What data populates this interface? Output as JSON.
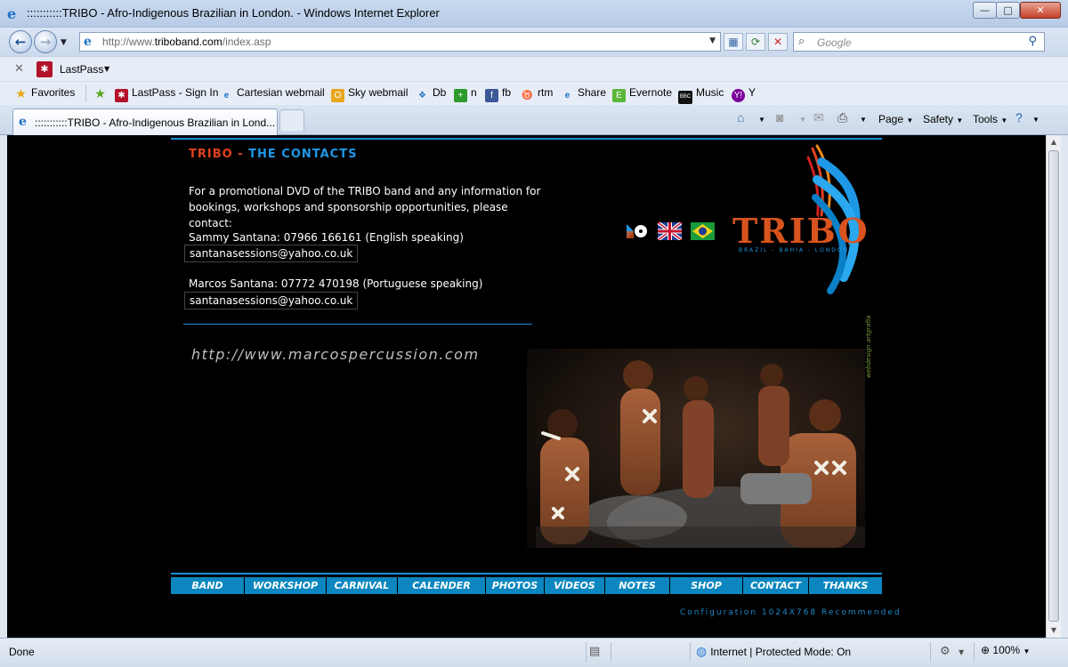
{
  "window": {
    "title": ":::::::::::TRIBO - Afro-Indigenous Brazilian in London. - Windows Internet Explorer",
    "minimize": "—",
    "maximize": "□",
    "close": "✕"
  },
  "address": {
    "url_prefix": "http://www.",
    "url_domain": "triboband.com",
    "url_path": "/index.asp",
    "search_placeholder": "Google"
  },
  "lastpass": {
    "label": "LastPass"
  },
  "favorites": {
    "label": "Favorites",
    "items": [
      {
        "label": "LastPass - Sign In",
        "icon": "lastpass-icon"
      },
      {
        "label": "Cartesian webmail",
        "icon": "ie-page-icon"
      },
      {
        "label": "Sky webmail",
        "icon": "outlook-icon"
      },
      {
        "label": "Db",
        "icon": "dropbox-icon"
      },
      {
        "label": "n",
        "icon": "plus-icon"
      },
      {
        "label": "fb",
        "icon": "facebook-icon"
      },
      {
        "label": "rtm",
        "icon": "cow-icon"
      },
      {
        "label": "Share",
        "icon": "ie-page-icon"
      },
      {
        "label": "Evernote",
        "icon": "evernote-icon"
      },
      {
        "label": "Music",
        "icon": "bbc-icon"
      },
      {
        "label": "Y",
        "icon": "yahoo-icon"
      }
    ]
  },
  "tab": {
    "label": ":::::::::::TRIBO - Afro-Indigenous Brazilian in Lond..."
  },
  "commandbar": {
    "page": "Page",
    "safety": "Safety",
    "tools": "Tools"
  },
  "site": {
    "heading_red": "TRIBO - ",
    "heading_blue": "THE CONTACTS",
    "intro": "For a promotional DVD of the TRIBO band and any information for bookings, workshops and sponsorship opportunities, please contact:",
    "contacts": [
      {
        "line": "Sammy Santana: 07966 166161 (English speaking)",
        "email": "santanasessions@yahoo.co.uk"
      },
      {
        "line": "Marcos Santana: 07772 470198 (Portuguese speaking)",
        "email": "santanasessions@yahoo.co.uk"
      }
    ],
    "website": "http://www.marcospercussion.com",
    "logo": "TRIBO",
    "logo_sub": "BRAZIL - BAHIA - LONDON",
    "credit": "webdesign artgrafia",
    "nav": [
      "BAND",
      "WORKSHOP",
      "CARNIVAL",
      "CALENDER",
      "PHOTOS",
      "VÍDEOS",
      "NOTES",
      "SHOP",
      "CONTACT",
      "THANKS"
    ],
    "config": "Configuration 1024X768 Recommended"
  },
  "status": {
    "text": "Done",
    "zone": "Internet | Protected Mode: On",
    "zoom": "100%"
  }
}
